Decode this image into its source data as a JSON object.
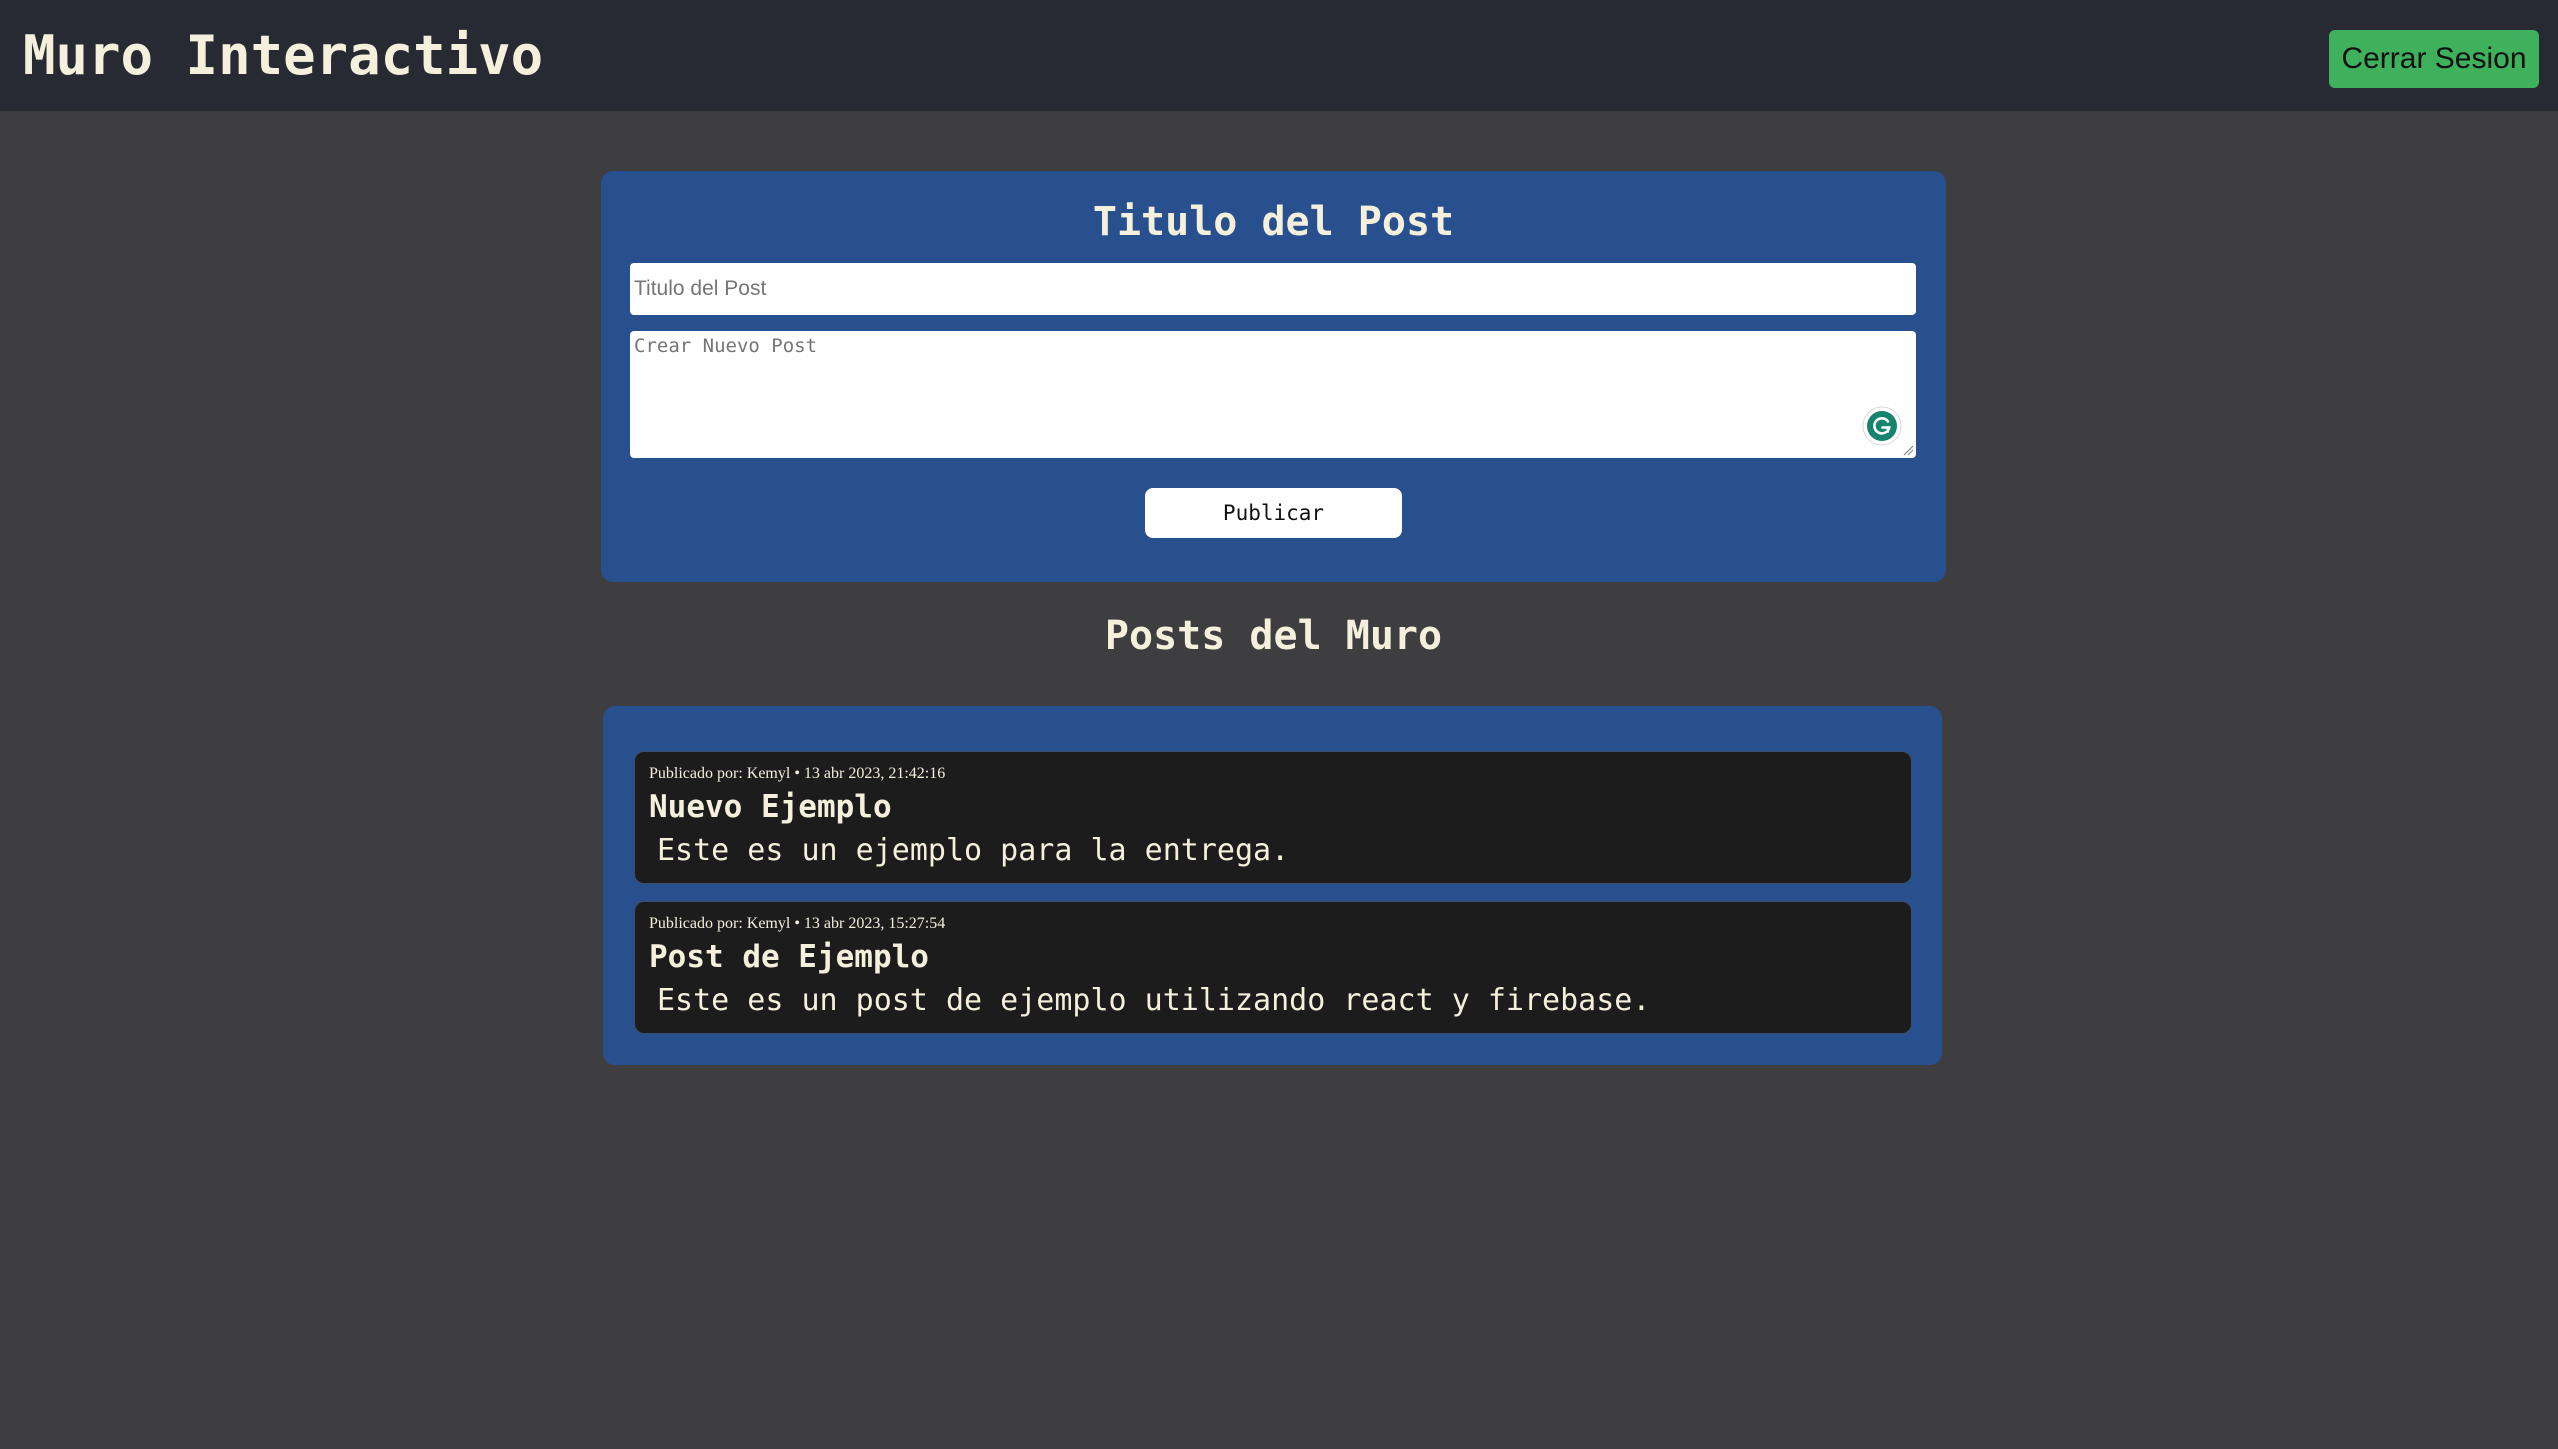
{
  "header": {
    "title": "Muro Interactivo",
    "logout_label": "Cerrar Sesion"
  },
  "composer": {
    "heading": "Titulo del Post",
    "title_placeholder": "Titulo del Post",
    "title_value": "",
    "content_placeholder": "Crear Nuevo Post",
    "content_value": "",
    "publish_label": "Publicar",
    "extension_icon": "grammarly-icon"
  },
  "feed": {
    "heading": "Posts del Muro",
    "posts": [
      {
        "meta": "Publicado por: Kemyl • 13 abr 2023, 21:42:16",
        "title": "Nuevo Ejemplo",
        "body": "Este es un ejemplo para la entrega."
      },
      {
        "meta": "Publicado por: Kemyl • 13 abr 2023, 15:27:54",
        "title": "Post de Ejemplo",
        "body": "Este es un post de ejemplo utilizando react y firebase."
      }
    ]
  },
  "colors": {
    "page_background": "#3e3e40",
    "header_background": "#282a33",
    "panel_background": "#28508f",
    "card_background": "#1c1c1d",
    "text": "#f4f0dc",
    "logout_button": "#3fb05c",
    "grammarly": "#15846c"
  }
}
